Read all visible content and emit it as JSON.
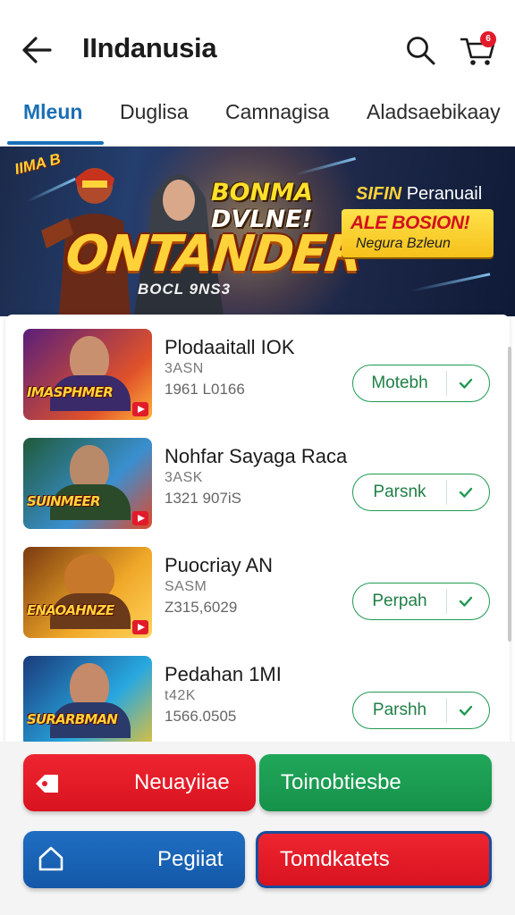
{
  "header": {
    "title": "IIndanusia",
    "cart_badge": "6"
  },
  "tabs": [
    {
      "label": "Mleun",
      "active": true
    },
    {
      "label": "Duglisa",
      "active": false
    },
    {
      "label": "Camnagisa",
      "active": false
    },
    {
      "label": "Aladsaebikaay",
      "active": false
    }
  ],
  "banner": {
    "corner_text": "IIMA B",
    "headline_1": "BONMA",
    "headline_2": "DVLNE!",
    "logo_text": "ONTANDER",
    "logo_sub": "BOCL 9NS3",
    "right_top_bold": "SIFIN",
    "right_top_text": "Peranuail",
    "promo_line1": "ALE BOSION!",
    "promo_line2": "Negura Bzleun"
  },
  "items": [
    {
      "title": "Plodaaitall IOK",
      "sub1": "3ASN",
      "sub2": "1961 L0166",
      "button": "Motebh",
      "thumb_label": "IMASPHMER",
      "thumb_colors": [
        "#5a1f7a",
        "#e0522a"
      ]
    },
    {
      "title": "Nohfar Sayaga Raca",
      "sub1": "3ASK",
      "sub2": "1321 907iS",
      "button": "Parsnk",
      "thumb_label": "SUINMEER",
      "thumb_colors": [
        "#1f5a3a",
        "#3a8fd0"
      ]
    },
    {
      "title": "Puocriay AN",
      "sub1": "SASM",
      "sub2": "Z315,6029",
      "button": "Perpah",
      "thumb_label": "ENAOAHNZE",
      "thumb_colors": [
        "#7a3a10",
        "#f0a828"
      ]
    },
    {
      "title": "Pedahan 1MI",
      "sub1": "t42K",
      "sub2": "1566.0505",
      "button": "Parshh",
      "thumb_label": "SURARBMAN",
      "thumb_colors": [
        "#1a3a7a",
        "#28a8e0"
      ]
    }
  ],
  "actions": [
    {
      "label": "Neuayiiae",
      "icon": "tag-icon",
      "color": "#e21b2b"
    },
    {
      "label": "Toinobtiesbe",
      "icon": "none",
      "color": "#1c9c53"
    },
    {
      "label": "Pegiiat",
      "icon": "home-icon",
      "color": "#1a64b8"
    },
    {
      "label": "Tomdkatets",
      "icon": "none",
      "color": "#e21b2b"
    }
  ],
  "colors": {
    "accent": "#1a6fb5",
    "green": "#1f9a52",
    "red": "#e21b2b",
    "blue": "#1a64b8"
  }
}
